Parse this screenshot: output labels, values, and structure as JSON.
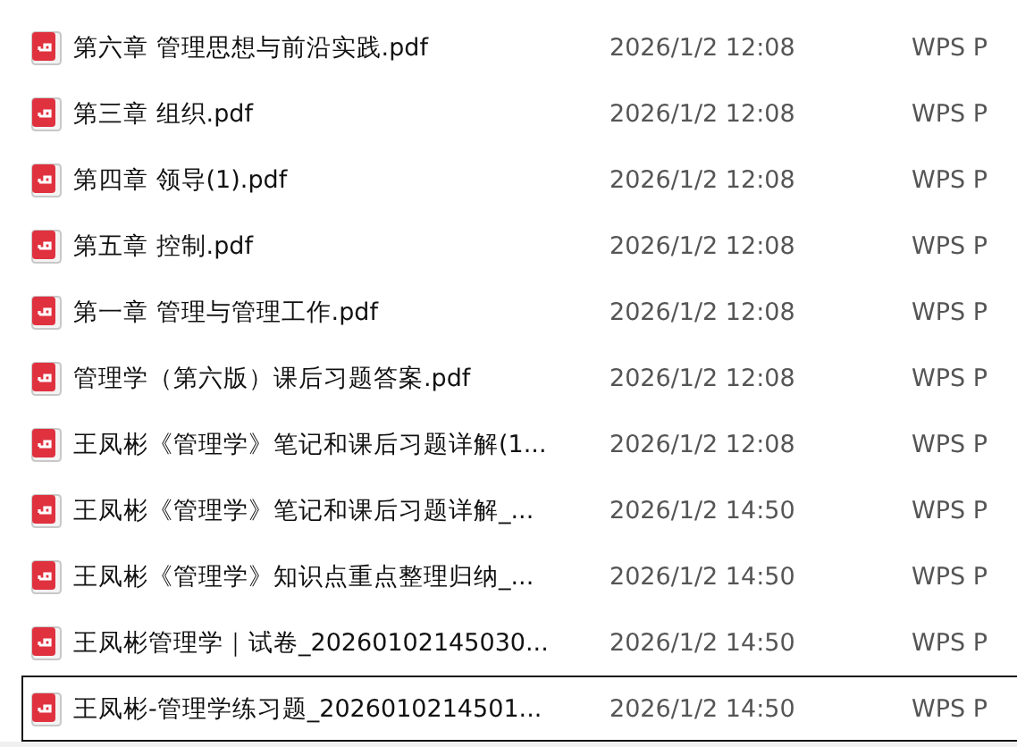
{
  "files": [
    {
      "name": "第六章 管理思想与前沿实践.pdf",
      "modified": "2026/1/2 12:08",
      "type": "WPS P",
      "selected": false
    },
    {
      "name": "第三章 组织.pdf",
      "modified": "2026/1/2 12:08",
      "type": "WPS P",
      "selected": false
    },
    {
      "name": "第四章 领导(1).pdf",
      "modified": "2026/1/2 12:08",
      "type": "WPS P",
      "selected": false
    },
    {
      "name": "第五章 控制.pdf",
      "modified": "2026/1/2 12:08",
      "type": "WPS P",
      "selected": false
    },
    {
      "name": "第一章 管理与管理工作.pdf",
      "modified": "2026/1/2 12:08",
      "type": "WPS P",
      "selected": false
    },
    {
      "name": "管理学（第六版）课后习题答案.pdf",
      "modified": "2026/1/2 12:08",
      "type": "WPS P",
      "selected": false
    },
    {
      "name": "王凤彬《管理学》笔记和课后习题详解(1...",
      "modified": "2026/1/2 12:08",
      "type": "WPS P",
      "selected": false
    },
    {
      "name": "王凤彬《管理学》笔记和课后习题详解_...",
      "modified": "2026/1/2 14:50",
      "type": "WPS P",
      "selected": false
    },
    {
      "name": "王凤彬《管理学》知识点重点整理归纳_...",
      "modified": "2026/1/2 14:50",
      "type": "WPS P",
      "selected": false
    },
    {
      "name": "王凤彬管理学｜试卷_20260102145030...",
      "modified": "2026/1/2 14:50",
      "type": "WPS P",
      "selected": false
    },
    {
      "name": "王凤彬-管理学练习题_2026010214501...",
      "modified": "2026/1/2 14:50",
      "type": "WPS P",
      "selected": true
    }
  ]
}
